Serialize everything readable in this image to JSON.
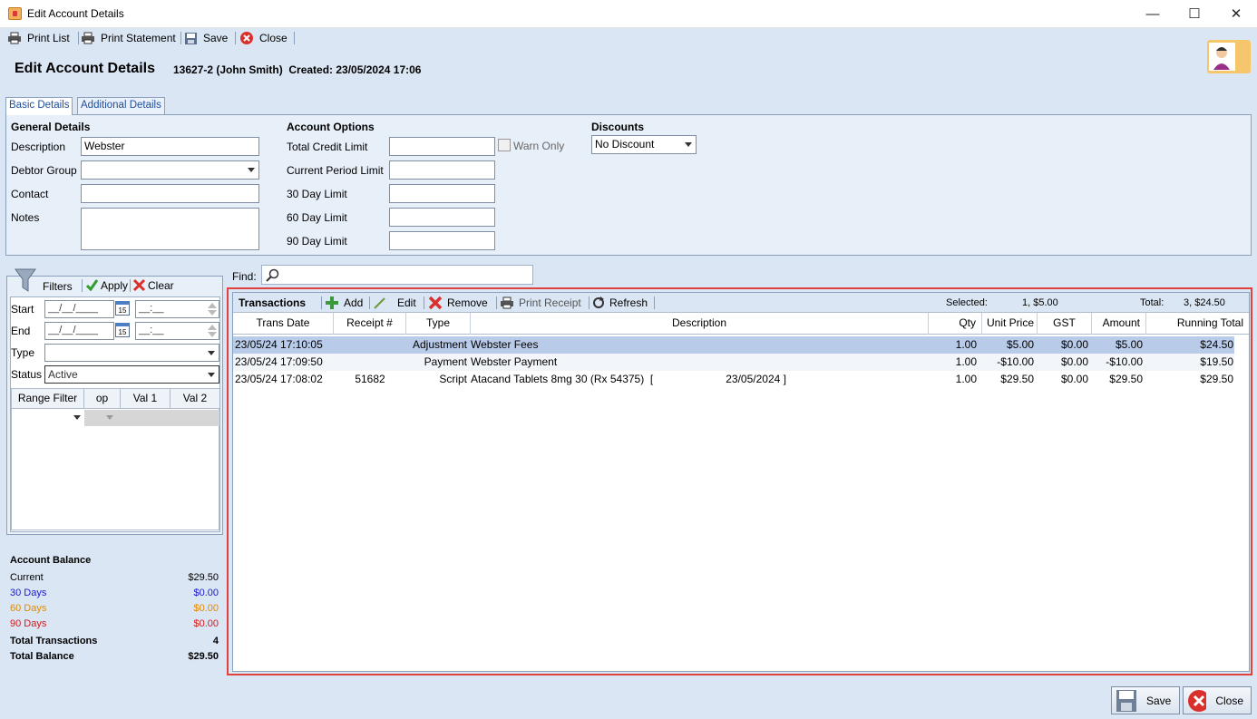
{
  "window": {
    "title": "Edit Account Details"
  },
  "toolbar": {
    "print_list": "Print List",
    "print_statement": "Print Statement",
    "save": "Save",
    "close": "Close"
  },
  "header": {
    "title": "Edit Account Details",
    "info": "13627-2 (John Smith)  Created: 23/05/2024 17:06"
  },
  "tabs": {
    "basic": "Basic Details",
    "additional": "Additional Details"
  },
  "general": {
    "heading": "General Details",
    "description_label": "Description",
    "description_value": "Webster",
    "debtor_group_label": "Debtor Group",
    "debtor_group_value": "",
    "contact_label": "Contact",
    "contact_value": "",
    "notes_label": "Notes",
    "notes_value": ""
  },
  "account_options": {
    "heading": "Account Options",
    "total_credit_limit_label": "Total Credit Limit",
    "warn_only_label": "Warn Only",
    "current_period_limit_label": "Current Period Limit",
    "limit_30_label": "30 Day Limit",
    "limit_60_label": "60 Day Limit",
    "limit_90_label": "90 Day Limit"
  },
  "discounts": {
    "heading": "Discounts",
    "value": "No Discount"
  },
  "find": {
    "label": "Find:"
  },
  "filters": {
    "title": "Filters",
    "apply": "Apply",
    "clear": "Clear",
    "start_label": "Start",
    "end_label": "End",
    "type_label": "Type",
    "status_label": "Status",
    "date_placeholder": "__/__/____",
    "time_placeholder": "__:__",
    "status_value": "Active",
    "range_headers": [
      "Range Filter",
      "op",
      "Val 1",
      "Val 2"
    ]
  },
  "balance": {
    "heading": "Account Balance",
    "current_label": "Current",
    "current_value": "$29.50",
    "d30_label": "30 Days",
    "d30_value": "$0.00",
    "d60_label": "60 Days",
    "d60_value": "$0.00",
    "d90_label": "90 Days",
    "d90_value": "$0.00",
    "total_trans_label": "Total Transactions",
    "total_trans_value": "4",
    "total_balance_label": "Total Balance",
    "total_balance_value": "$29.50",
    "colors": {
      "d30": "#1a1ad0",
      "d60": "#e08a00",
      "d90": "#d01a1a"
    }
  },
  "transactions": {
    "title": "Transactions",
    "add": "Add",
    "edit": "Edit",
    "remove": "Remove",
    "print_receipt": "Print Receipt",
    "refresh": "Refresh",
    "selected_label": "Selected:",
    "selected_value": "1, $5.00",
    "total_label": "Total:",
    "total_value": "3, $24.50",
    "columns": [
      "Trans Date",
      "Receipt #",
      "Type",
      "Description",
      "Qty",
      "Unit Price",
      "GST",
      "Amount",
      "Running Total"
    ],
    "rows": [
      {
        "date": "23/05/24 17:10:05",
        "receipt": "",
        "type": "Adjustment",
        "description": "Webster Fees",
        "qty": "1.00",
        "unit_price": "$5.00",
        "gst": "$0.00",
        "amount": "$5.00",
        "running_total": "$24.50"
      },
      {
        "date": "23/05/24 17:09:50",
        "receipt": "",
        "type": "Payment",
        "description": "Webster Payment",
        "qty": "1.00",
        "unit_price": "-$10.00",
        "gst": "$0.00",
        "amount": "-$10.00",
        "running_total": "$19.50"
      },
      {
        "date": "23/05/24 17:08:02",
        "receipt": "51682",
        "type": "Script",
        "description": "Atacand Tablets 8mg 30 (Rx 54375)  [                        23/05/2024 ]",
        "qty": "1.00",
        "unit_price": "$29.50",
        "gst": "$0.00",
        "amount": "$29.50",
        "running_total": "$29.50"
      }
    ]
  },
  "footer": {
    "save": "Save",
    "close": "Close"
  },
  "colors": {
    "highlight": "#e0403e",
    "selected_row": "#b8cbe8",
    "panel_bg": "#dbe6f4"
  }
}
